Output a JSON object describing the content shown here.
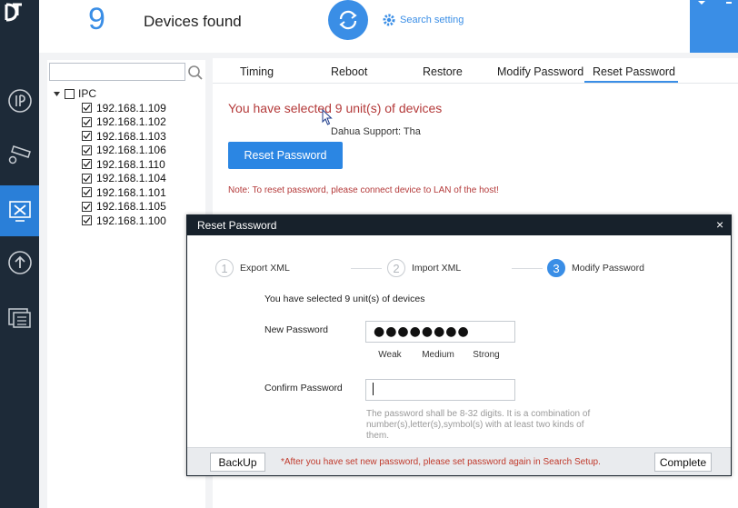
{
  "header": {
    "device_count": "9",
    "devices_found_label": "Devices found",
    "search_setting_label": "Search setting"
  },
  "tree": {
    "search_placeholder": "",
    "root_label": "IPC",
    "devices": [
      "192.168.1.109",
      "192.168.1.102",
      "192.168.1.103",
      "192.168.1.106",
      "192.168.1.110",
      "192.168.1.104",
      "192.168.1.101",
      "192.168.1.105",
      "192.168.1.100"
    ]
  },
  "tabs": [
    "Timing",
    "Reboot",
    "Restore",
    "Modify Password",
    "Reset Password"
  ],
  "active_tab": "Reset Password",
  "panel": {
    "selected_text": "You have selected 9 unit(s) of devices",
    "tooltip_text": "Dahua Support: Tha",
    "reset_button": "Reset Password",
    "note": "Note: To reset password, please connect device to LAN of the host!"
  },
  "dialog": {
    "title": "Reset Password",
    "close": "×",
    "steps": [
      {
        "num": "1",
        "label": "Export XML"
      },
      {
        "num": "2",
        "label": "Import XML"
      },
      {
        "num": "3",
        "label": "Modify Password"
      }
    ],
    "current_step": 3,
    "selected_text": "You have selected 9 unit(s) of devices",
    "new_password_label": "New Password",
    "new_password_value": "●●●●●●●●",
    "strength": [
      "Weak",
      "Medium",
      "Strong"
    ],
    "strength_level": "Medium",
    "confirm_password_label": "Confirm Password",
    "confirm_password_value": "",
    "hint": "The password shall be 8-32 digits. It is a combination of number(s),letter(s),symbol(s) with at least two kinds of them.",
    "backup_button": "BackUp",
    "footer_note": "*After you have set new password, please set password again in Search Setup.",
    "complete_button": "Complete"
  },
  "colors": {
    "accent": "#3a8ee6",
    "rail": "#1d2a38",
    "warning": "#b43a3a",
    "strength_on": "#3cb043"
  }
}
